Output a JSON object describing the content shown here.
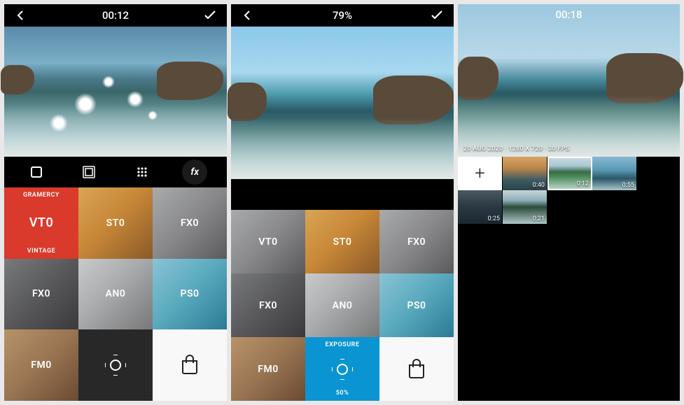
{
  "panel1": {
    "time": "00:12",
    "filters": {
      "r1c1": {
        "label": "VT0",
        "top": "GRAMERCY",
        "bottom": "VINTAGE"
      },
      "r1c2": {
        "label": "ST0"
      },
      "r1c3": {
        "label": "FX0"
      },
      "r2c1": {
        "label": "FX0"
      },
      "r2c2": {
        "label": "AN0"
      },
      "r2c3": {
        "label": "PS0"
      },
      "r3c1": {
        "label": "FM0"
      }
    }
  },
  "panel2": {
    "progress": "79%",
    "filters": {
      "r1c1": {
        "label": "VT0"
      },
      "r1c2": {
        "label": "ST0"
      },
      "r1c3": {
        "label": "FX0"
      },
      "r2c1": {
        "label": "FX0"
      },
      "r2c2": {
        "label": "AN0"
      },
      "r2c3": {
        "label": "PS0"
      },
      "r3c1": {
        "label": "FM0"
      },
      "r3c2": {
        "top": "EXPOSURE",
        "bottom": "50%"
      }
    }
  },
  "panel3": {
    "time": "00:18",
    "meta": "20 AUG 2020 · 1280 X 720 · 30 FPS",
    "clips": [
      {
        "type": "add"
      },
      {
        "dur": "0:40"
      },
      {
        "dur": "0:12"
      },
      {
        "dur": "0:55"
      },
      {
        "dur": "0:25"
      },
      {
        "dur": "0:21"
      }
    ]
  }
}
